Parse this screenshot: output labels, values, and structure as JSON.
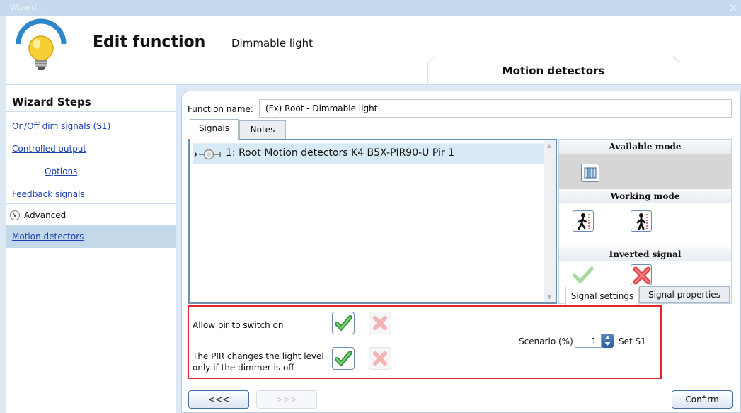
{
  "window": {
    "title": "Wizard...",
    "close_glyph": "×"
  },
  "header": {
    "title": "Edit function",
    "subtitle": "Dimmable light",
    "step_tab": "Motion detectors",
    "icon": "light-bulb-icon"
  },
  "sidebar": {
    "title": "Wizard Steps",
    "items": [
      {
        "label": "On/Off dim signals (S1)"
      },
      {
        "label": "Controlled output"
      },
      {
        "label": "Options"
      },
      {
        "label": "Feedback signals"
      },
      {
        "label": "Advanced"
      },
      {
        "label": "Motion detectors",
        "selected": true
      }
    ]
  },
  "main": {
    "function_name_label": "Function name:",
    "function_name_value": "(Fx) Root - Dimmable light",
    "tabs": [
      {
        "label": "Signals",
        "active": true
      },
      {
        "label": "Notes"
      }
    ],
    "signals": [
      {
        "label": "1: Root Motion detectors K4 B5X-PIR90-U Pir 1"
      }
    ]
  },
  "right_pane": {
    "available_mode": "Available mode",
    "working_mode": "Working mode",
    "inverted_signal": "Inverted signal",
    "tabs": [
      {
        "label": "Signal settings",
        "active": true
      },
      {
        "label": "Signal properties"
      }
    ]
  },
  "options": {
    "allow_pir": "Allow pir to switch on",
    "pir_changes_line1": "The PIR changes the light level",
    "pir_changes_line2": "only if the dimmer is off",
    "scenario_label": "Scenario (%)",
    "scenario_value": "1",
    "set_label": "Set S1"
  },
  "buttons": {
    "prev": "<<<",
    "next": ">>>",
    "confirm": "Confirm"
  },
  "colors": {
    "highlight_box": "#e0252b",
    "accent": "#1a3fb0",
    "selection": "#c3d9ea"
  }
}
